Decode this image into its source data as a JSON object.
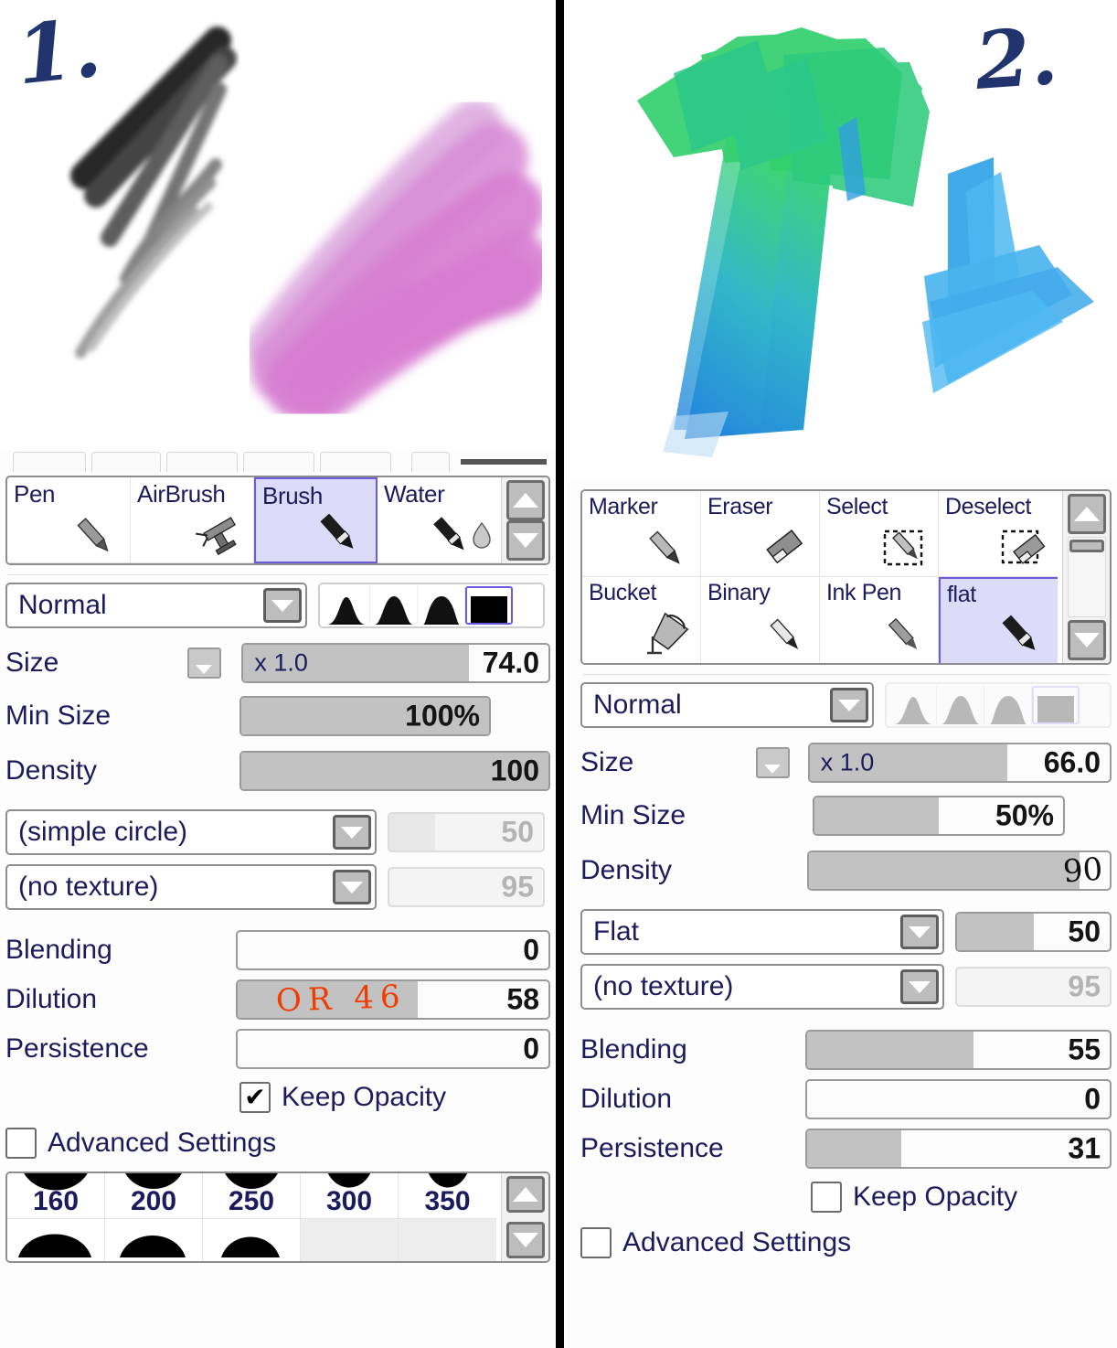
{
  "annotations": {
    "left_number": "1.",
    "right_number": "2.",
    "dilution_note": "OR 46",
    "density_note": "90"
  },
  "left_panel": {
    "tools": [
      {
        "label": "Pen",
        "icon": "pen-icon",
        "selected": false
      },
      {
        "label": "AirBrush",
        "icon": "airbrush-icon",
        "selected": false
      },
      {
        "label": "Brush",
        "icon": "brush-icon",
        "selected": true
      },
      {
        "label": "Water",
        "icon": "water-icon",
        "selected": false
      }
    ],
    "blend_mode": "Normal",
    "shape_selected_index": 3,
    "size": {
      "label": "Size",
      "prefix": "x 1.0",
      "value": "74.0",
      "fill_pct": 74
    },
    "min_size": {
      "label": "Min Size",
      "value": "100%",
      "fill_pct": 100
    },
    "density": {
      "label": "Density",
      "value": "100",
      "fill_pct": 100
    },
    "brush_shape": {
      "name": "(simple circle)",
      "value": "50",
      "fill_pct": 30,
      "disabled": true
    },
    "texture": {
      "name": "(no texture)",
      "value": "95",
      "fill_pct": 0,
      "disabled": true
    },
    "blending": {
      "label": "Blending",
      "value": "0",
      "fill_pct": 0
    },
    "dilution": {
      "label": "Dilution",
      "value": "58",
      "fill_pct": 58
    },
    "persistence": {
      "label": "Persistence",
      "value": "0",
      "fill_pct": 0
    },
    "keep_opacity": {
      "label": "Keep Opacity",
      "checked": true
    },
    "advanced_settings": {
      "label": "Advanced Settings",
      "checked": false
    },
    "size_presets": [
      "160",
      "200",
      "250",
      "300",
      "350"
    ]
  },
  "right_panel": {
    "tools": [
      {
        "label": "Marker",
        "icon": "marker-icon",
        "selected": false
      },
      {
        "label": "Eraser",
        "icon": "eraser-icon",
        "selected": false
      },
      {
        "label": "Select",
        "icon": "select-icon",
        "selected": false
      },
      {
        "label": "Deselect",
        "icon": "deselect-icon",
        "selected": false
      },
      {
        "label": "Bucket",
        "icon": "bucket-icon",
        "selected": false
      },
      {
        "label": "Binary",
        "icon": "binary-icon",
        "selected": false
      },
      {
        "label": "Ink Pen",
        "icon": "inkpen-icon",
        "selected": false
      },
      {
        "label": "flat",
        "icon": "flat-brush-icon",
        "selected": true
      }
    ],
    "blend_mode": "Normal",
    "shape_selected_index": 3,
    "shapes_disabled": true,
    "size": {
      "label": "Size",
      "prefix": "x 1.0",
      "value": "66.0",
      "fill_pct": 66
    },
    "min_size": {
      "label": "Min Size",
      "value": "50%",
      "fill_pct": 50
    },
    "density": {
      "label": "Density",
      "value": "90",
      "fill_pct": 90
    },
    "brush_shape": {
      "name": "Flat",
      "value": "50",
      "fill_pct": 50,
      "disabled": false
    },
    "texture": {
      "name": "(no texture)",
      "value": "95",
      "fill_pct": 0,
      "disabled": true
    },
    "blending": {
      "label": "Blending",
      "value": "55",
      "fill_pct": 55
    },
    "dilution": {
      "label": "Dilution",
      "value": "0",
      "fill_pct": 0
    },
    "persistence": {
      "label": "Persistence",
      "value": "31",
      "fill_pct": 31
    },
    "keep_opacity": {
      "label": "Keep Opacity",
      "checked": false
    },
    "advanced_settings": {
      "label": "Advanced Settings",
      "checked": false
    }
  },
  "colors": {
    "selection": "#6a5ae0",
    "selection_bg": "#dcdcfa",
    "slider_fill": "#c2c2c2",
    "text_blue": "#1b1b5e",
    "hand_blue": "#22346e",
    "hand_red": "#f03c00",
    "stroke_pink": "#d97fd2",
    "stroke_green": "#33d06e",
    "stroke_blue": "#2a8fe0",
    "stroke_deep_blue": "#1a7de0",
    "stroke_gray": "#7a7a7a",
    "stroke_black": "#2d2d2d"
  }
}
